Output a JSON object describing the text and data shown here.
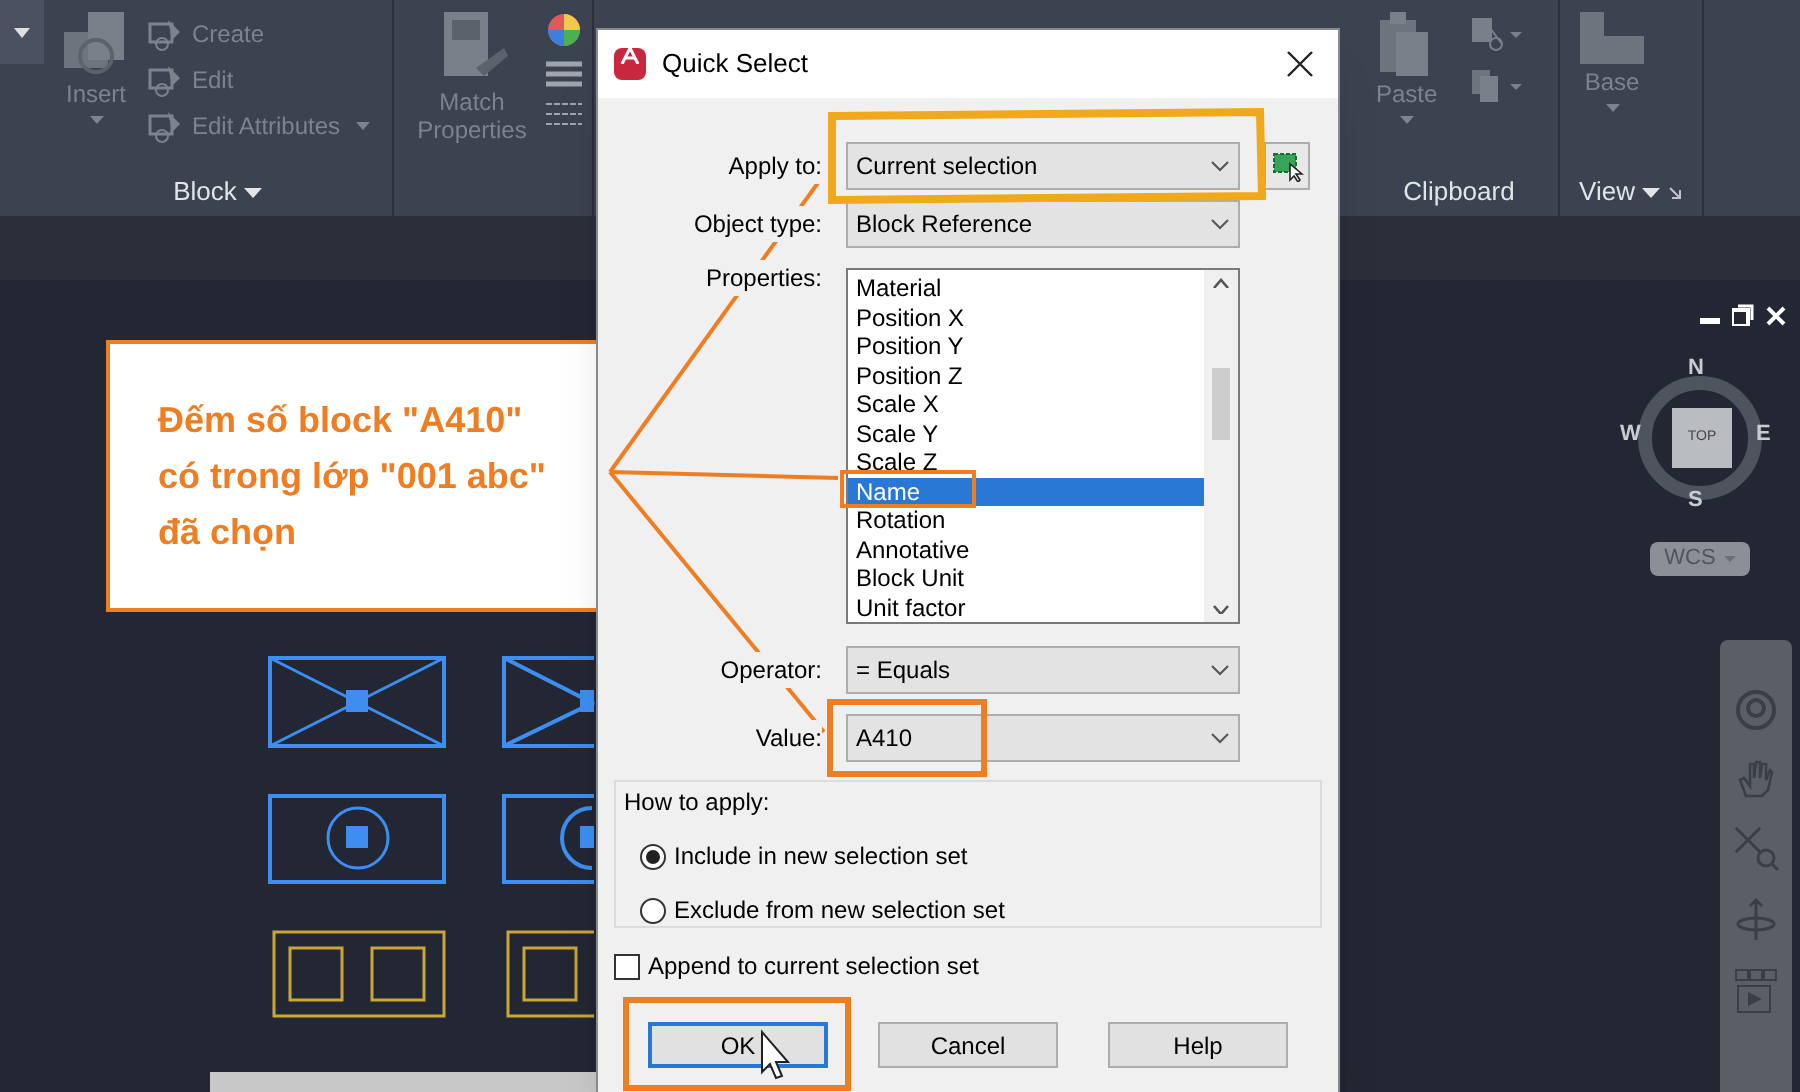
{
  "ribbon": {
    "panels": [
      {
        "kind": "block",
        "title": "Block",
        "tools": [
          {
            "label": "Insert"
          }
        ],
        "small_tools": [
          {
            "label": "Create"
          },
          {
            "label": "Edit"
          },
          {
            "label": "Edit Attributes"
          }
        ]
      },
      {
        "kind": "properties",
        "tools": [
          {
            "label": "Match Properties"
          }
        ]
      },
      {
        "kind": "clipboard",
        "title": "Clipboard",
        "tools": [
          {
            "label": "Paste"
          }
        ]
      },
      {
        "kind": "view",
        "title": "View",
        "tools": [
          {
            "label": "Base"
          }
        ]
      }
    ]
  },
  "viewcube": {
    "face": "TOP",
    "north": "N",
    "east": "E",
    "south": "S",
    "west": "W",
    "coordinate_system": "WCS"
  },
  "callout": {
    "text": "Đếm số block \"A410\" có trong lớp \"001 abc\" đã chọn"
  },
  "dialog": {
    "title": "Quick Select",
    "apply_to": {
      "label": "Apply to:",
      "value": "Current selection"
    },
    "object_type": {
      "label": "Object type:",
      "value": "Block Reference"
    },
    "properties": {
      "label": "Properties:",
      "items": [
        {
          "text": "Material",
          "selected": false
        },
        {
          "text": "Position X",
          "selected": false
        },
        {
          "text": "Position Y",
          "selected": false
        },
        {
          "text": "Position Z",
          "selected": false
        },
        {
          "text": "Scale X",
          "selected": false
        },
        {
          "text": "Scale Y",
          "selected": false
        },
        {
          "text": "Scale Z",
          "selected": false
        },
        {
          "text": "Name",
          "selected": true
        },
        {
          "text": "Rotation",
          "selected": false
        },
        {
          "text": "Annotative",
          "selected": false
        },
        {
          "text": "Block Unit",
          "selected": false
        },
        {
          "text": "Unit factor",
          "selected": false
        }
      ]
    },
    "operator": {
      "label": "Operator:",
      "value": "= Equals"
    },
    "value": {
      "label": "Value:",
      "value": "A410"
    },
    "how_to_apply": {
      "label": "How to apply:",
      "options": [
        {
          "text": "Include in new selection set",
          "selected": true
        },
        {
          "text": "Exclude from new selection set",
          "selected": false
        }
      ]
    },
    "append": {
      "text": "Append to current selection set",
      "checked": false
    },
    "buttons": [
      {
        "label": "OK",
        "default": true
      },
      {
        "label": "Cancel",
        "default": false
      },
      {
        "label": "Help",
        "default": false
      }
    ]
  }
}
